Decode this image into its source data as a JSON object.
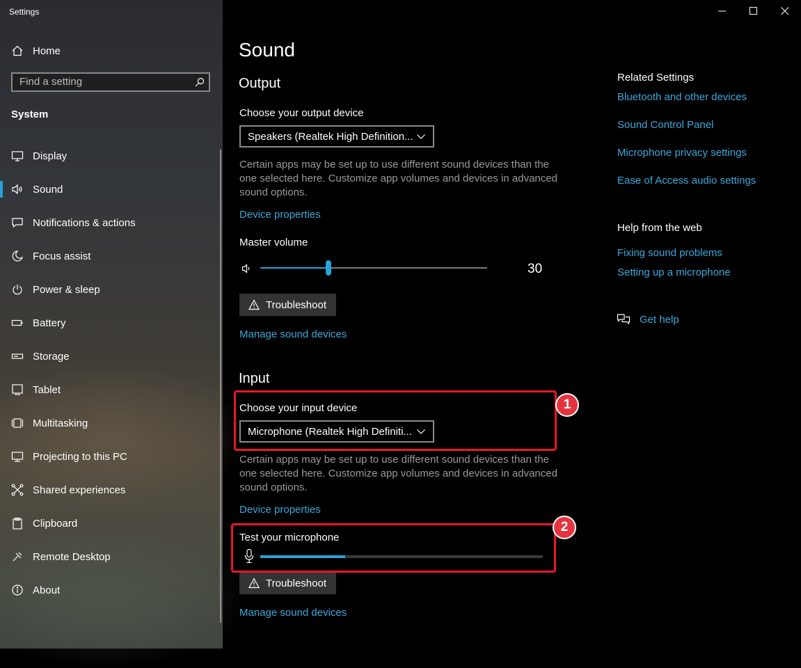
{
  "window": {
    "title": "Settings"
  },
  "sidebar": {
    "home_label": "Home",
    "search_placeholder": "Find a setting",
    "section": "System",
    "items": [
      {
        "label": "Display",
        "icon": "display-icon"
      },
      {
        "label": "Sound",
        "icon": "speaker-icon",
        "active": true
      },
      {
        "label": "Notifications & actions",
        "icon": "notifications-icon"
      },
      {
        "label": "Focus assist",
        "icon": "moon-icon"
      },
      {
        "label": "Power & sleep",
        "icon": "power-icon"
      },
      {
        "label": "Battery",
        "icon": "battery-icon"
      },
      {
        "label": "Storage",
        "icon": "storage-icon"
      },
      {
        "label": "Tablet",
        "icon": "tablet-icon"
      },
      {
        "label": "Multitasking",
        "icon": "multitasking-icon"
      },
      {
        "label": "Projecting to this PC",
        "icon": "projecting-icon"
      },
      {
        "label": "Shared experiences",
        "icon": "shared-experiences-icon"
      },
      {
        "label": "Clipboard",
        "icon": "clipboard-icon"
      },
      {
        "label": "Remote Desktop",
        "icon": "remote-desktop-icon"
      },
      {
        "label": "About",
        "icon": "info-icon"
      }
    ]
  },
  "main": {
    "title": "Sound",
    "output": {
      "heading": "Output",
      "device_label": "Choose your output device",
      "device_value": "Speakers (Realtek High Definition...",
      "description": "Certain apps may be set up to use different sound devices than the one selected here. Customize app volumes and devices in advanced sound options.",
      "device_properties": "Device properties",
      "master_volume_label": "Master volume",
      "volume": 30,
      "troubleshoot": "Troubleshoot",
      "manage": "Manage sound devices"
    },
    "input": {
      "heading": "Input",
      "device_label": "Choose your input device",
      "device_value": "Microphone (Realtek High Definiti...",
      "description": "Certain apps may be set up to use different sound devices than the one selected here. Customize app volumes and devices in advanced sound options.",
      "device_properties": "Device properties",
      "test_label": "Test your microphone",
      "mic_level": 0.3,
      "troubleshoot": "Troubleshoot",
      "manage": "Manage sound devices"
    },
    "annotations": [
      "1",
      "2"
    ]
  },
  "related": {
    "title": "Related Settings",
    "links": [
      "Bluetooth and other devices",
      "Sound Control Panel",
      "Microphone privacy settings",
      "Ease of Access audio settings"
    ],
    "help_title": "Help from the web",
    "help_links": [
      "Fixing sound problems",
      "Setting up a microphone"
    ],
    "get_help": "Get help"
  },
  "colors": {
    "accent": "#29a3d9",
    "link": "#3aa8dc",
    "annotation": "#e8162b"
  }
}
